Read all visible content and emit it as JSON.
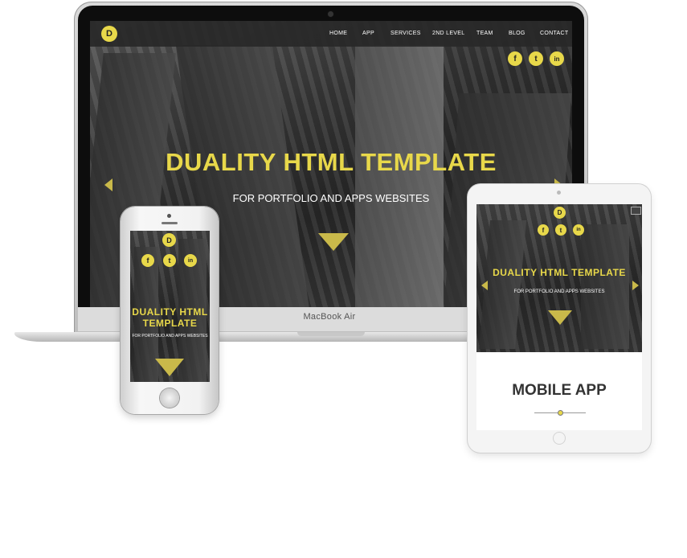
{
  "brand": {
    "logo_letter": "D",
    "accent_color": "#e8d84a"
  },
  "laptop": {
    "nav": [
      "HOME",
      "APP",
      "SERVICES",
      "2ND LEVEL",
      "TEAM",
      "BLOG",
      "CONTACT"
    ],
    "social": [
      "f",
      "t",
      "in"
    ],
    "hero_title": "DUALITY HTML TEMPLATE",
    "hero_subtitle": "FOR PORTFOLIO AND APPS WEBSITES",
    "device_label": "MacBook Air"
  },
  "phone": {
    "social": [
      "f",
      "t",
      "in"
    ],
    "hero_title_line1": "DUALITY HTML",
    "hero_title_line2": "TEMPLATE",
    "hero_subtitle": "FOR PORTFOLIO AND APPS WEBSITES"
  },
  "tablet": {
    "social": [
      "f",
      "t",
      "in"
    ],
    "hero_title": "DUALITY HTML TEMPLATE",
    "hero_subtitle": "FOR PORTFOLIO AND APPS WEBSITES",
    "section_title": "MOBILE APP"
  }
}
